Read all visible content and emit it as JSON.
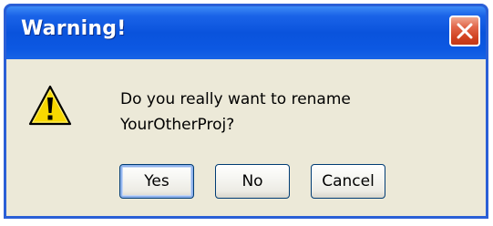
{
  "dialog": {
    "title": "Warning!",
    "close_icon": "close-icon",
    "icon": "warning-icon",
    "message_line1": "Do you really want to rename",
    "message_line2": "YourOtherProj?"
  },
  "buttons": {
    "yes_label": "Yes",
    "no_label": "No",
    "cancel_label": "Cancel"
  },
  "colors": {
    "titlebar": "#0a53dc",
    "client": "#ece9d8",
    "close_button": "#d0411f",
    "warning_yellow": "#f8d800"
  }
}
